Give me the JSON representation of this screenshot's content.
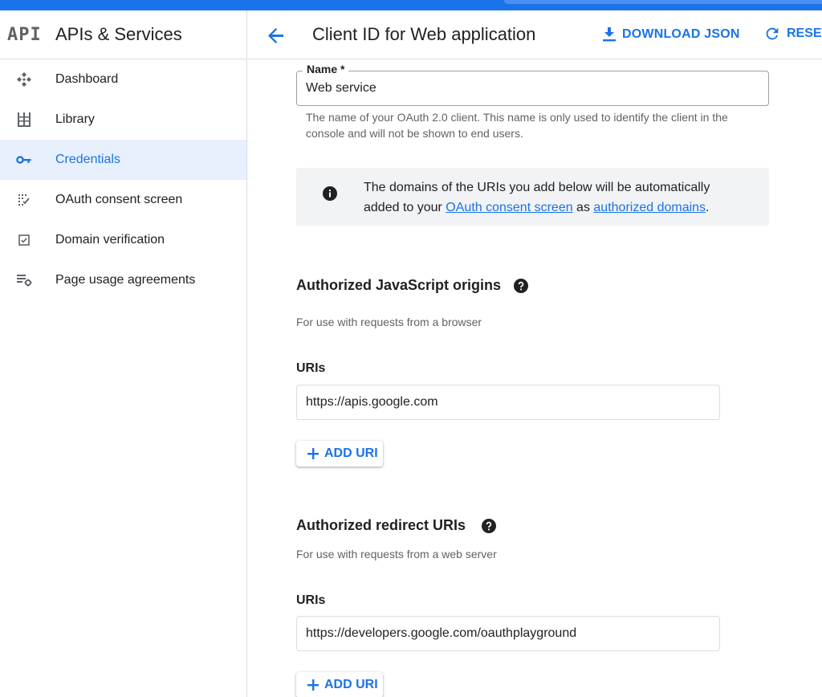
{
  "app": {
    "logo_text": "API",
    "title": "APIs & Services"
  },
  "sidebar": {
    "items": [
      {
        "label": "Dashboard",
        "icon": "dashboard-icon",
        "active": false
      },
      {
        "label": "Library",
        "icon": "library-icon",
        "active": false
      },
      {
        "label": "Credentials",
        "icon": "key-icon",
        "active": true
      },
      {
        "label": "OAuth consent screen",
        "icon": "consent-icon",
        "active": false
      },
      {
        "label": "Domain verification",
        "icon": "checkbox-icon",
        "active": false
      },
      {
        "label": "Page usage agreements",
        "icon": "settings-list-icon",
        "active": false
      }
    ]
  },
  "header": {
    "title": "Client ID for Web application",
    "download_label": "DOWNLOAD JSON",
    "reset_label": "RESET"
  },
  "form": {
    "name_label": "Name *",
    "name_value": "Web service",
    "name_hint": "The name of your OAuth 2.0 client. This name is only used to identify the client in the console and will not be shown to end users.",
    "info": {
      "text_before": "The domains of the URIs you add below will be automatically added to your ",
      "link1": "OAuth consent screen",
      "text_mid": " as ",
      "link2": "authorized domains",
      "text_after": "."
    },
    "js_origins": {
      "title": "Authorized JavaScript origins",
      "subtitle": "For use with requests from a browser",
      "uris_label": "URIs",
      "uri_value": "https://apis.google.com",
      "add_label": "ADD URI"
    },
    "redirect_uris": {
      "title": "Authorized redirect URIs",
      "subtitle": "For use with requests from a web server",
      "uris_label": "URIs",
      "uri_value": "https://developers.google.com/oauthplayground",
      "add_label": "ADD URI"
    }
  },
  "colors": {
    "accent": "#1a73e8",
    "active_bg": "#e8f0fe",
    "info_bg": "#f1f3f4"
  }
}
